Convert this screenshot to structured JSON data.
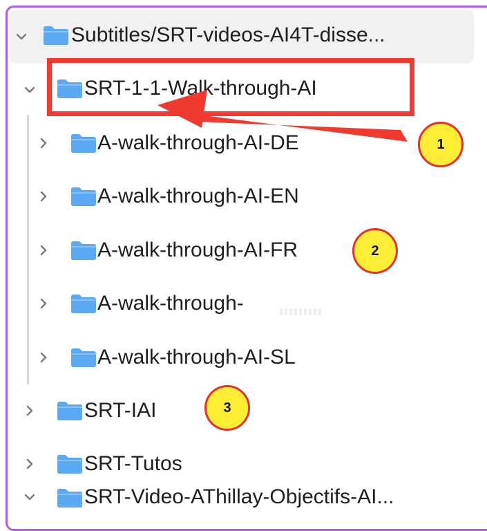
{
  "tree": {
    "root": {
      "label": "Subtitles/SRT-videos-AI4T-disse...",
      "expanded": true
    },
    "selected": {
      "label": "SRT-1-1-Walk-through-AI",
      "expanded": true
    },
    "children": [
      {
        "label": "A-walk-through-AI-DE",
        "expanded": false
      },
      {
        "label": "A-walk-through-AI-EN",
        "expanded": false
      },
      {
        "label": "A-walk-through-AI-FR",
        "expanded": false
      },
      {
        "label": "A-walk-through-",
        "expanded": false
      },
      {
        "label": "A-walk-through-AI-SL",
        "expanded": false
      }
    ],
    "siblings": [
      {
        "label": "SRT-IAI",
        "expanded": false
      },
      {
        "label": "SRT-Tutos",
        "expanded": false
      },
      {
        "label": "SRT-Video-AThillay-Objectifs-AI...",
        "expanded": true
      }
    ]
  },
  "annotations": {
    "badges": [
      "1",
      "2",
      "3"
    ],
    "colors": {
      "highlight": "#f03a30",
      "badge_fill": "#fdee35",
      "badge_border": "#e3322b",
      "folder": "#5aa9f2",
      "frame": "#b05ce6"
    }
  },
  "icons": {
    "folder": "folder-icon",
    "chevron_expanded": "chevron-down-icon",
    "chevron_collapsed": "chevron-right-icon"
  }
}
